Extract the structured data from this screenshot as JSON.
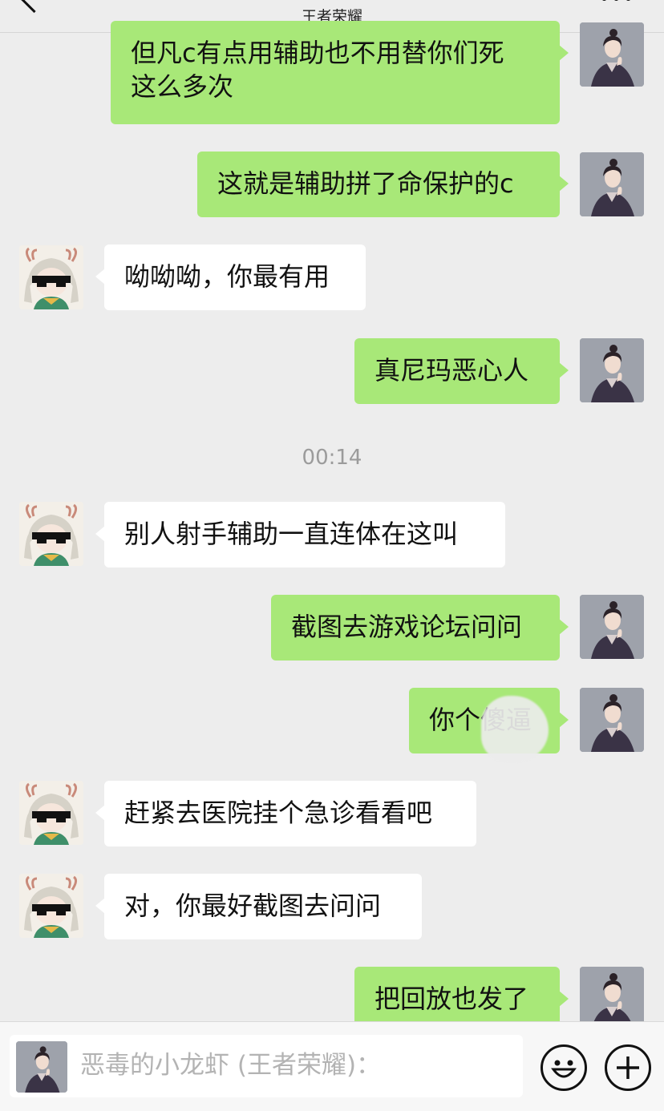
{
  "header": {
    "subtitle": "王者荣耀"
  },
  "messages": [
    {
      "side": "me",
      "text": "但凡c有点用辅助也不用替你们死\n这么多次"
    },
    {
      "side": "me",
      "text": "这就是辅助拼了命保护的c"
    },
    {
      "side": "other",
      "text": "呦呦呦，你最有用"
    },
    {
      "side": "me",
      "text": "真尼玛恶心人"
    },
    {
      "side": "other",
      "text": "别人射手辅助一直连体在这叫"
    },
    {
      "side": "me",
      "text": "截图去游戏论坛问问"
    },
    {
      "side": "me",
      "text": "你个傻逼"
    },
    {
      "side": "other",
      "text": "赶紧去医院挂个急诊看看吧"
    },
    {
      "side": "other",
      "text": "对，你最好截图去问问"
    },
    {
      "side": "me",
      "text": "把回放也发了"
    }
  ],
  "timestamp": "00:14",
  "input": {
    "placeholder": "恶毒的小龙虾 (王者荣耀)："
  },
  "colors": {
    "self_bubble": "#a8e878",
    "other_bubble": "#ffffff",
    "background": "#ededed"
  },
  "icons": {
    "back": "chevron-left-icon",
    "more": "more-dots-icon",
    "emoji": "emoji-icon",
    "plus": "plus-circle-icon"
  }
}
